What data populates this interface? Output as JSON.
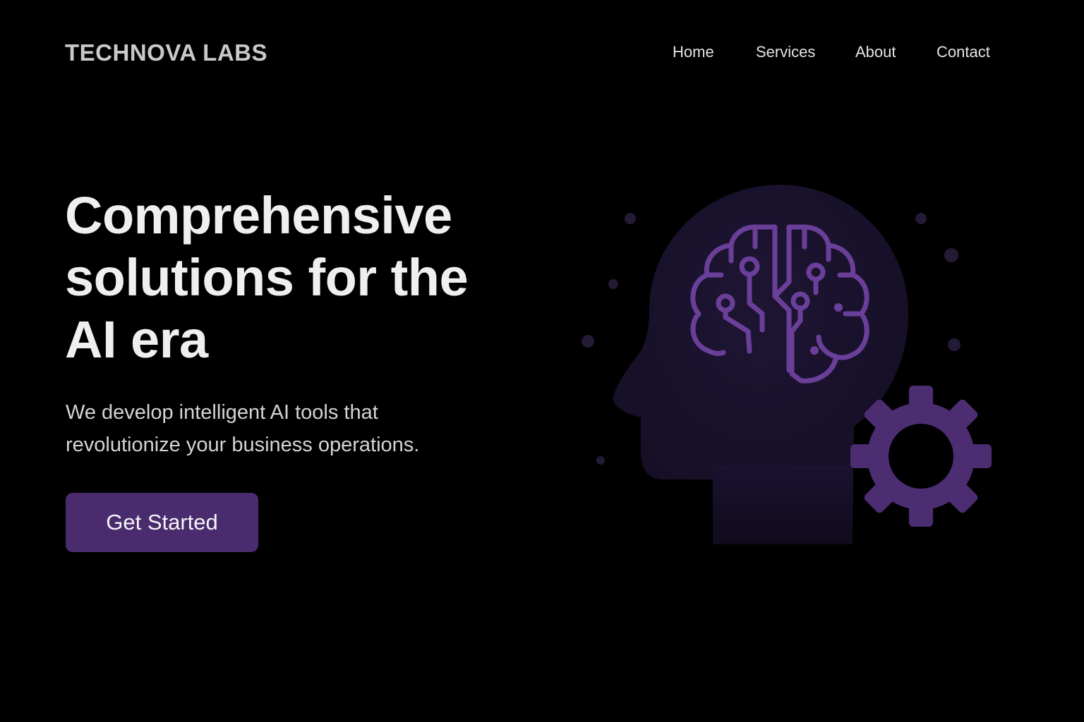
{
  "brand": {
    "name": "TECHNOVA LABS"
  },
  "nav": {
    "items": [
      "Home",
      "Services",
      "About",
      "Contact"
    ]
  },
  "hero": {
    "headline_lines": [
      "Comprehensive",
      "solutions for the",
      "AI era"
    ],
    "subtext_lines": [
      "We develop intelligent AI tools that",
      "revolutionize your business operations."
    ],
    "cta_label": "Get Started"
  },
  "illustration": {
    "icons": [
      "head-silhouette-icon",
      "circuit-brain-icon",
      "gear-icon"
    ]
  },
  "colors": {
    "background": "#000000",
    "accent": "#4a2c6e",
    "circuit": "#6a3f9a",
    "head": "#1c1430",
    "text": "#efeff2"
  }
}
